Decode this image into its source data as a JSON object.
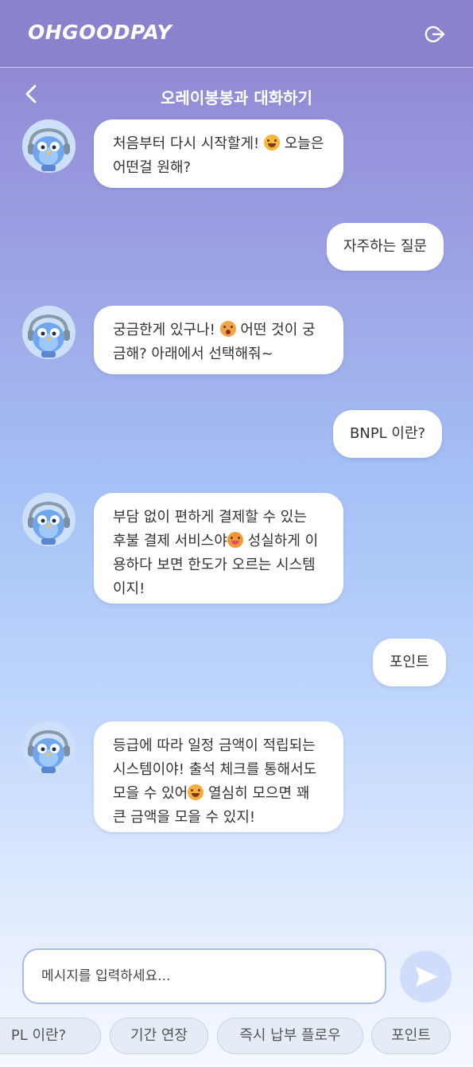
{
  "header": {
    "logo": "OHGOODPAY",
    "logout_icon": "logout-icon"
  },
  "subheader": {
    "back_icon": "chevron-left-icon",
    "title": "오레이봉봉과 대화하기"
  },
  "messages": [
    {
      "from": "bot",
      "avatar_icon": "owl-mascot-icon",
      "parts": [
        "처음부터 다시 시작할게! ",
        " 오늘은 어떤걸 원해?"
      ],
      "emoji": "smiling-face-icon"
    },
    {
      "from": "user",
      "text": "자주하는 질문"
    },
    {
      "from": "bot",
      "avatar_icon": "owl-mascot-icon",
      "parts": [
        "궁금한게 있구나! ",
        " 어떤 것이 궁금해? 아래에서 선택해줘~"
      ],
      "emoji": "flushed-face-icon"
    },
    {
      "from": "user",
      "text": "BNPL 이란?"
    },
    {
      "from": "bot",
      "avatar_icon": "owl-mascot-icon",
      "parts": [
        "부담 없이 편하게 결제할 수 있는 후불 결제 서비스야",
        " 성실하게 이용하다 보면 한도가 오르는 시스템이지!"
      ],
      "emoji": "tongue-face-icon"
    },
    {
      "from": "user",
      "text": "포인트"
    },
    {
      "from": "bot",
      "avatar_icon": "owl-mascot-icon",
      "parts": [
        "등급에 따라 일정 금액이 적립되는 시스템이야! 출석 체크를 통해서도 모을 수 있어",
        " 열심히 모으면 꽤 큰 금액을 모을 수 있지!"
      ],
      "emoji": "savoring-face-icon"
    }
  ],
  "composer": {
    "placeholder": "메시지를 입력하세요...",
    "send_icon": "send-icon"
  },
  "quick_replies": [
    "PL 이란?",
    "기간 연장",
    "즉시 납부 플로우",
    "포인트"
  ]
}
